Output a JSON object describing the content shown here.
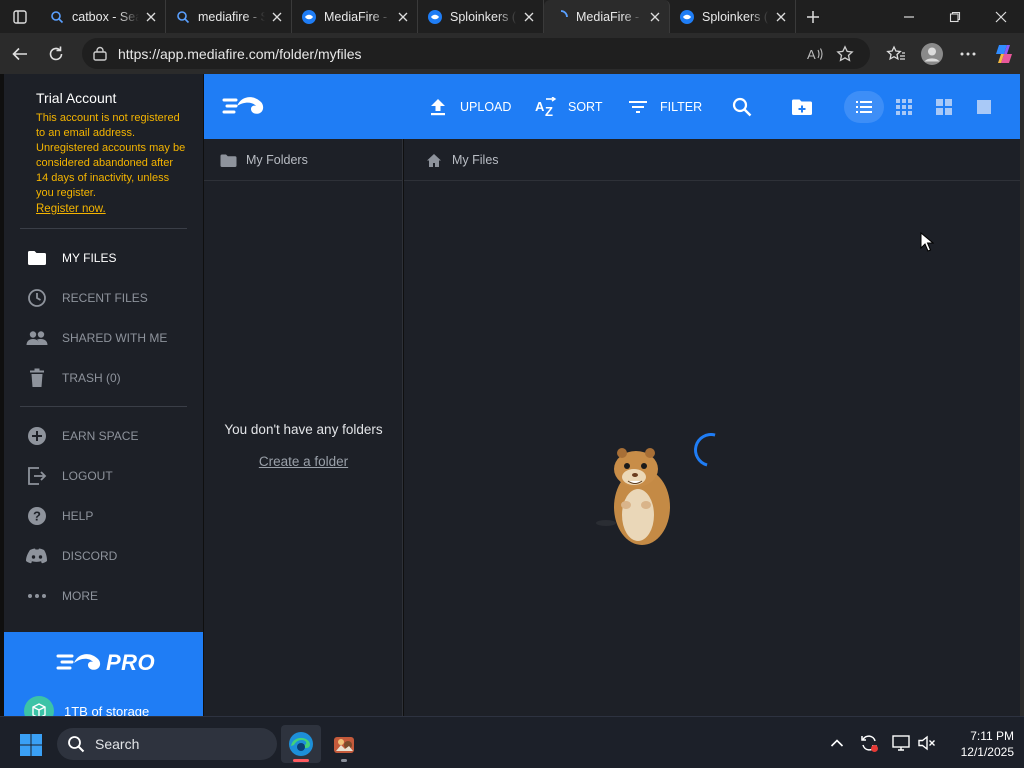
{
  "browser": {
    "tabs": [
      {
        "title": "catbox - Sea",
        "favicon": "search-icon",
        "active": false
      },
      {
        "title": "mediafire - S",
        "favicon": "search-icon",
        "active": false
      },
      {
        "title": "MediaFire - (",
        "favicon": "mediafire-icon",
        "active": false
      },
      {
        "title": "Sploinkers (I",
        "favicon": "mediafire-icon",
        "active": false
      },
      {
        "title": "MediaFire - (",
        "favicon": "loading-icon",
        "active": true
      },
      {
        "title": "Sploinkers (I",
        "favicon": "mediafire-icon",
        "active": false
      }
    ],
    "url": "https://app.mediafire.com/folder/myfiles"
  },
  "sidebar": {
    "account_title": "Trial Account",
    "account_warning": "This account is not registered to an email address. Unregistered accounts may be considered abandoned after 14 days of inactivity, unless you register.",
    "register_link": "Register now.",
    "nav": [
      {
        "label": "MY FILES",
        "icon": "folder-icon",
        "active": true
      },
      {
        "label": "RECENT FILES",
        "icon": "clock-icon",
        "active": false
      },
      {
        "label": "SHARED WITH ME",
        "icon": "people-icon",
        "active": false
      },
      {
        "label": "TRASH (0)",
        "icon": "trash-icon",
        "active": false
      }
    ],
    "nav2": [
      {
        "label": "EARN SPACE",
        "icon": "plus-circle-icon"
      },
      {
        "label": "LOGOUT",
        "icon": "logout-icon"
      },
      {
        "label": "HELP",
        "icon": "help-icon"
      },
      {
        "label": "DISCORD",
        "icon": "discord-icon"
      },
      {
        "label": "MORE",
        "icon": "more-icon"
      }
    ],
    "pro": {
      "label": "PRO",
      "storage": "1TB of storage"
    }
  },
  "header": {
    "upload": "UPLOAD",
    "sort": "SORT",
    "filter": "FILTER"
  },
  "folders_pane": {
    "title": "My Folders",
    "empty_text": "You don't have any folders",
    "create_link": "Create a folder"
  },
  "files_pane": {
    "breadcrumb": "My Files"
  },
  "taskbar": {
    "search_placeholder": "Search",
    "time": "7:11 PM",
    "date": "12/1/2025"
  },
  "colors": {
    "brand_blue": "#1f7df5",
    "warning": "#f4b400",
    "panel": "#1d2027"
  }
}
